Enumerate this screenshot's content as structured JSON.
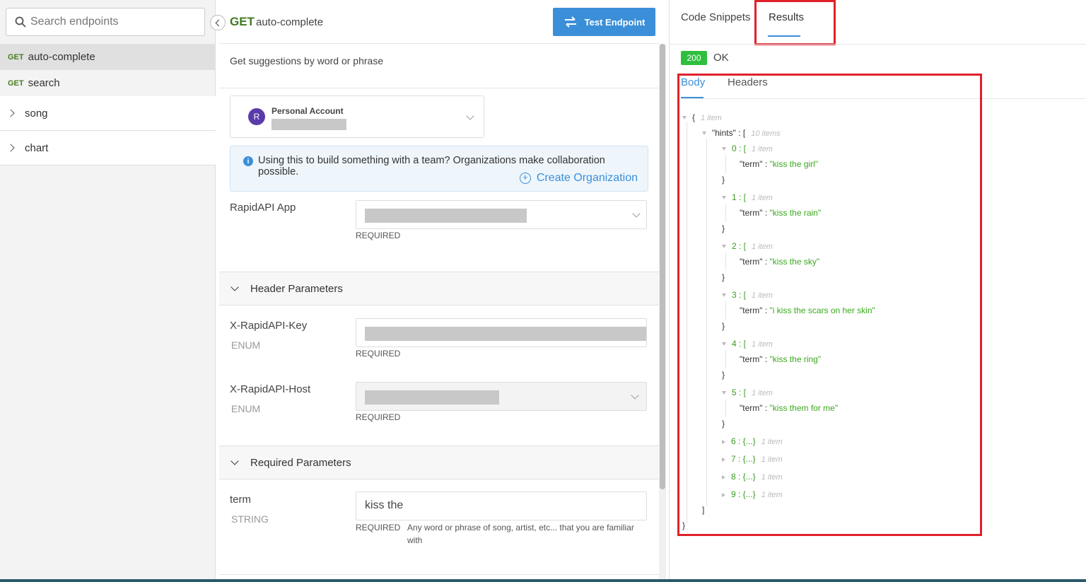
{
  "sidebar": {
    "search_placeholder": "Search endpoints",
    "endpoints": [
      {
        "method": "GET",
        "name": "auto-complete"
      },
      {
        "method": "GET",
        "name": "search"
      }
    ],
    "groups": [
      "song",
      "chart"
    ]
  },
  "middle": {
    "method": "GET",
    "endpoint_name": "auto-complete",
    "test_button": "Test Endpoint",
    "description": "Get suggestions by word or phrase",
    "account_label": "Personal Account",
    "account_initial": "R",
    "info_text": "Using this to build something with a team? Organizations make collaboration possible.",
    "create_org": "Create Organization",
    "rapidapi_app_label": "RapidAPI App",
    "required": "REQUIRED",
    "header_params_title": "Header Parameters",
    "key_label": "X-RapidAPI-Key",
    "host_label": "X-RapidAPI-Host",
    "enum": "ENUM",
    "required_params_title": "Required Parameters",
    "term_label": "term",
    "term_type": "STRING",
    "term_value": "kiss the",
    "term_help": "Any word or phrase of song, artist, etc... that you are familiar with"
  },
  "right": {
    "tabs": [
      "Code Snippets",
      "Results"
    ],
    "status_code": "200",
    "status_text": "OK",
    "body_tabs": [
      "Body",
      "Headers"
    ],
    "json": {
      "root_open": "{",
      "root_meta": "1 item",
      "hints_key": "\"hints\"",
      "hints_open": "[",
      "hints_meta": "10 items",
      "item_meta": "1 item",
      "term_key": "\"term\"",
      "expanded": [
        {
          "idx": "0",
          "term": "\"kiss the girl\""
        },
        {
          "idx": "1",
          "term": "\"kiss the rain\""
        },
        {
          "idx": "2",
          "term": "\"kiss the sky\""
        },
        {
          "idx": "3",
          "term": "\"i kiss the scars on her skin\""
        },
        {
          "idx": "4",
          "term": "\"kiss the ring\""
        },
        {
          "idx": "5",
          "term": "\"kiss them for me\""
        }
      ],
      "collapsed": [
        "6",
        "7",
        "8",
        "9"
      ],
      "collapsed_text": "{...}"
    }
  }
}
